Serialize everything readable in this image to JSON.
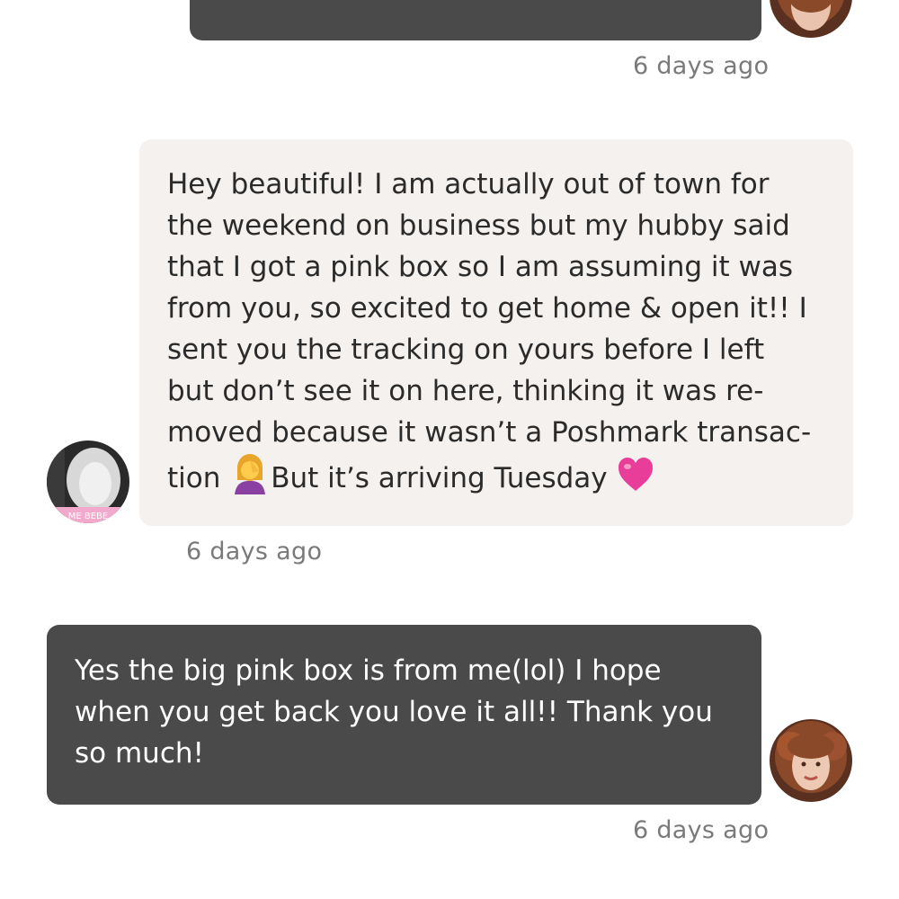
{
  "messages": [
    {
      "sender": "me",
      "text": "",
      "time": "6 days ago"
    },
    {
      "sender": "other",
      "text": "Hey beautiful! I am actually out of town for\nthe weekend on business but my hubby said\nthat I got a pink box so I am assuming it was\nfrom you, so excited to get home & open it!! I\nsent you the tracking on yours before I left\nbut don’t see it on here, thinking it was re-\nmoved because it wasn’t a Poshmark transac-",
      "last_line_start": "tion ",
      "last_line_mid": "But it’s arriving Tuesday ",
      "emojis": [
        "facepalm-woman-emoji",
        "pink-heart-emoji"
      ],
      "time": "6 days ago",
      "avatar_text": "ME BEBE"
    },
    {
      "sender": "me",
      "text": "Yes the big pink box is from me(lol) I hope\nwhen you get back you love it all!! Thank you\nso much!",
      "time": "6 days ago"
    }
  ],
  "colors": {
    "sent_bubble": "#4a4a4a",
    "received_bubble": "#f4f1ef",
    "timestamp": "#7a7a7a"
  }
}
